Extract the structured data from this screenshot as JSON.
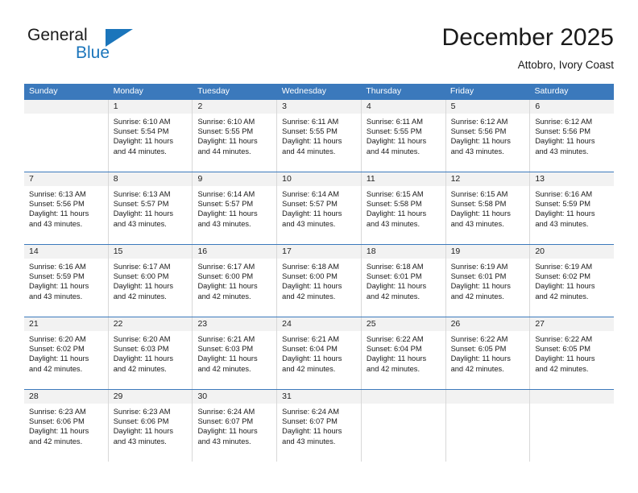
{
  "logo": {
    "primary_text": "General",
    "secondary_text": "Blue",
    "accent_color": "#1b75bb",
    "triangle_icon": "logo-triangle-icon"
  },
  "header": {
    "title": "December 2025",
    "subtitle": "Attobro, Ivory Coast"
  },
  "colors": {
    "header_blue": "#3b79bc",
    "daynum_background": "#f2f2f2",
    "cell_border": "#d8d8d8",
    "text": "#1a1a1a"
  },
  "weekdays": [
    "Sunday",
    "Monday",
    "Tuesday",
    "Wednesday",
    "Thursday",
    "Friday",
    "Saturday"
  ],
  "weeks": [
    [
      {
        "day": "",
        "sunrise": "",
        "sunset": "",
        "daylight1": "",
        "daylight2": ""
      },
      {
        "day": "1",
        "sunrise": "Sunrise: 6:10 AM",
        "sunset": "Sunset: 5:54 PM",
        "daylight1": "Daylight: 11 hours",
        "daylight2": "and 44 minutes."
      },
      {
        "day": "2",
        "sunrise": "Sunrise: 6:10 AM",
        "sunset": "Sunset: 5:55 PM",
        "daylight1": "Daylight: 11 hours",
        "daylight2": "and 44 minutes."
      },
      {
        "day": "3",
        "sunrise": "Sunrise: 6:11 AM",
        "sunset": "Sunset: 5:55 PM",
        "daylight1": "Daylight: 11 hours",
        "daylight2": "and 44 minutes."
      },
      {
        "day": "4",
        "sunrise": "Sunrise: 6:11 AM",
        "sunset": "Sunset: 5:55 PM",
        "daylight1": "Daylight: 11 hours",
        "daylight2": "and 44 minutes."
      },
      {
        "day": "5",
        "sunrise": "Sunrise: 6:12 AM",
        "sunset": "Sunset: 5:56 PM",
        "daylight1": "Daylight: 11 hours",
        "daylight2": "and 43 minutes."
      },
      {
        "day": "6",
        "sunrise": "Sunrise: 6:12 AM",
        "sunset": "Sunset: 5:56 PM",
        "daylight1": "Daylight: 11 hours",
        "daylight2": "and 43 minutes."
      }
    ],
    [
      {
        "day": "7",
        "sunrise": "Sunrise: 6:13 AM",
        "sunset": "Sunset: 5:56 PM",
        "daylight1": "Daylight: 11 hours",
        "daylight2": "and 43 minutes."
      },
      {
        "day": "8",
        "sunrise": "Sunrise: 6:13 AM",
        "sunset": "Sunset: 5:57 PM",
        "daylight1": "Daylight: 11 hours",
        "daylight2": "and 43 minutes."
      },
      {
        "day": "9",
        "sunrise": "Sunrise: 6:14 AM",
        "sunset": "Sunset: 5:57 PM",
        "daylight1": "Daylight: 11 hours",
        "daylight2": "and 43 minutes."
      },
      {
        "day": "10",
        "sunrise": "Sunrise: 6:14 AM",
        "sunset": "Sunset: 5:57 PM",
        "daylight1": "Daylight: 11 hours",
        "daylight2": "and 43 minutes."
      },
      {
        "day": "11",
        "sunrise": "Sunrise: 6:15 AM",
        "sunset": "Sunset: 5:58 PM",
        "daylight1": "Daylight: 11 hours",
        "daylight2": "and 43 minutes."
      },
      {
        "day": "12",
        "sunrise": "Sunrise: 6:15 AM",
        "sunset": "Sunset: 5:58 PM",
        "daylight1": "Daylight: 11 hours",
        "daylight2": "and 43 minutes."
      },
      {
        "day": "13",
        "sunrise": "Sunrise: 6:16 AM",
        "sunset": "Sunset: 5:59 PM",
        "daylight1": "Daylight: 11 hours",
        "daylight2": "and 43 minutes."
      }
    ],
    [
      {
        "day": "14",
        "sunrise": "Sunrise: 6:16 AM",
        "sunset": "Sunset: 5:59 PM",
        "daylight1": "Daylight: 11 hours",
        "daylight2": "and 43 minutes."
      },
      {
        "day": "15",
        "sunrise": "Sunrise: 6:17 AM",
        "sunset": "Sunset: 6:00 PM",
        "daylight1": "Daylight: 11 hours",
        "daylight2": "and 42 minutes."
      },
      {
        "day": "16",
        "sunrise": "Sunrise: 6:17 AM",
        "sunset": "Sunset: 6:00 PM",
        "daylight1": "Daylight: 11 hours",
        "daylight2": "and 42 minutes."
      },
      {
        "day": "17",
        "sunrise": "Sunrise: 6:18 AM",
        "sunset": "Sunset: 6:00 PM",
        "daylight1": "Daylight: 11 hours",
        "daylight2": "and 42 minutes."
      },
      {
        "day": "18",
        "sunrise": "Sunrise: 6:18 AM",
        "sunset": "Sunset: 6:01 PM",
        "daylight1": "Daylight: 11 hours",
        "daylight2": "and 42 minutes."
      },
      {
        "day": "19",
        "sunrise": "Sunrise: 6:19 AM",
        "sunset": "Sunset: 6:01 PM",
        "daylight1": "Daylight: 11 hours",
        "daylight2": "and 42 minutes."
      },
      {
        "day": "20",
        "sunrise": "Sunrise: 6:19 AM",
        "sunset": "Sunset: 6:02 PM",
        "daylight1": "Daylight: 11 hours",
        "daylight2": "and 42 minutes."
      }
    ],
    [
      {
        "day": "21",
        "sunrise": "Sunrise: 6:20 AM",
        "sunset": "Sunset: 6:02 PM",
        "daylight1": "Daylight: 11 hours",
        "daylight2": "and 42 minutes."
      },
      {
        "day": "22",
        "sunrise": "Sunrise: 6:20 AM",
        "sunset": "Sunset: 6:03 PM",
        "daylight1": "Daylight: 11 hours",
        "daylight2": "and 42 minutes."
      },
      {
        "day": "23",
        "sunrise": "Sunrise: 6:21 AM",
        "sunset": "Sunset: 6:03 PM",
        "daylight1": "Daylight: 11 hours",
        "daylight2": "and 42 minutes."
      },
      {
        "day": "24",
        "sunrise": "Sunrise: 6:21 AM",
        "sunset": "Sunset: 6:04 PM",
        "daylight1": "Daylight: 11 hours",
        "daylight2": "and 42 minutes."
      },
      {
        "day": "25",
        "sunrise": "Sunrise: 6:22 AM",
        "sunset": "Sunset: 6:04 PM",
        "daylight1": "Daylight: 11 hours",
        "daylight2": "and 42 minutes."
      },
      {
        "day": "26",
        "sunrise": "Sunrise: 6:22 AM",
        "sunset": "Sunset: 6:05 PM",
        "daylight1": "Daylight: 11 hours",
        "daylight2": "and 42 minutes."
      },
      {
        "day": "27",
        "sunrise": "Sunrise: 6:22 AM",
        "sunset": "Sunset: 6:05 PM",
        "daylight1": "Daylight: 11 hours",
        "daylight2": "and 42 minutes."
      }
    ],
    [
      {
        "day": "28",
        "sunrise": "Sunrise: 6:23 AM",
        "sunset": "Sunset: 6:06 PM",
        "daylight1": "Daylight: 11 hours",
        "daylight2": "and 42 minutes."
      },
      {
        "day": "29",
        "sunrise": "Sunrise: 6:23 AM",
        "sunset": "Sunset: 6:06 PM",
        "daylight1": "Daylight: 11 hours",
        "daylight2": "and 43 minutes."
      },
      {
        "day": "30",
        "sunrise": "Sunrise: 6:24 AM",
        "sunset": "Sunset: 6:07 PM",
        "daylight1": "Daylight: 11 hours",
        "daylight2": "and 43 minutes."
      },
      {
        "day": "31",
        "sunrise": "Sunrise: 6:24 AM",
        "sunset": "Sunset: 6:07 PM",
        "daylight1": "Daylight: 11 hours",
        "daylight2": "and 43 minutes."
      },
      {
        "day": "",
        "sunrise": "",
        "sunset": "",
        "daylight1": "",
        "daylight2": ""
      },
      {
        "day": "",
        "sunrise": "",
        "sunset": "",
        "daylight1": "",
        "daylight2": ""
      },
      {
        "day": "",
        "sunrise": "",
        "sunset": "",
        "daylight1": "",
        "daylight2": ""
      }
    ]
  ]
}
